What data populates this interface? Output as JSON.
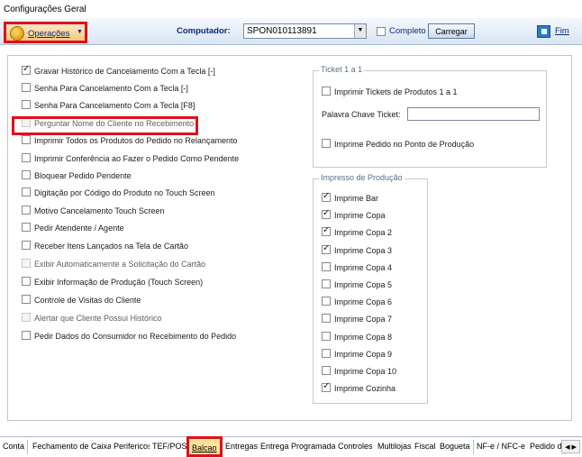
{
  "window_title": "Configurações Geral",
  "toolbar": {
    "operacoes_label": "Operações",
    "computador_label": "Computador:",
    "computador_value": "SPON010113891",
    "completo_label": "Completo",
    "carregar_label": "Carregar",
    "fim_label": "Fim"
  },
  "left_options": [
    {
      "label": "Gravar Histórico de Cancelamento Com a Tecla [-]",
      "checked": true,
      "enabled": true
    },
    {
      "label": "Senha Para Cancelamento Com a Tecla [-]",
      "checked": false,
      "enabled": true
    },
    {
      "label": "Senha Para Cancelamento Com a Tecla [F8]",
      "checked": false,
      "enabled": true
    },
    {
      "label": "Perguntar Nome do Cliente no Recebimento",
      "checked": false,
      "enabled": false
    },
    {
      "label": "Imprimir Todos os Produtos do Pedido no Relançamento",
      "checked": false,
      "enabled": true
    },
    {
      "label": "Imprimir Conferência ao Fazer o Pedido Como Pendente",
      "checked": false,
      "enabled": true
    },
    {
      "label": "Bloquear Pedido Pendente",
      "checked": false,
      "enabled": true
    },
    {
      "label": "Digitação por Código do Produto no Touch Screen",
      "checked": false,
      "enabled": true
    },
    {
      "label": "Motivo Cancelamento Touch Screen",
      "checked": false,
      "enabled": true
    },
    {
      "label": "Pedir Atendente / Agente",
      "checked": false,
      "enabled": true
    },
    {
      "label": "Receber Itens Lançados na Tela de Cartão",
      "checked": false,
      "enabled": true
    },
    {
      "label": "Exibir Automaticamente a Solicitação do Cartão",
      "checked": false,
      "enabled": false
    },
    {
      "label": "Exibir Informação de Produção (Touch Screen)",
      "checked": false,
      "enabled": true
    },
    {
      "label": "Controle de Visitas do Cliente",
      "checked": false,
      "enabled": true
    },
    {
      "label": "Alertar que Cliente Possui Histórico",
      "checked": false,
      "enabled": false
    },
    {
      "label": "Pedir Dados do Consumidor no Recebimento do Pedido",
      "checked": false,
      "enabled": true
    }
  ],
  "ticket_group": {
    "title": "Ticket 1 a 1",
    "imprimir_tickets_label": "Imprimir Tickets de Produtos 1 a 1",
    "palavra_chave_label": "Palavra Chave Ticket:",
    "palavra_chave_value": "",
    "imprime_pedido_label": "Imprime Pedido no Ponto de Produção"
  },
  "impresso_group": {
    "title": "Impresso de Produção",
    "items": [
      {
        "label": "Imprime Bar",
        "checked": true
      },
      {
        "label": "Imprime Copa",
        "checked": true
      },
      {
        "label": "Imprime Copa 2",
        "checked": true
      },
      {
        "label": "Imprime Copa 3",
        "checked": true
      },
      {
        "label": "Imprime Copa 4",
        "checked": false
      },
      {
        "label": "Imprime Copa 5",
        "checked": false
      },
      {
        "label": "Imprime Copa 6",
        "checked": false
      },
      {
        "label": "Imprime Copa 7",
        "checked": false
      },
      {
        "label": "Imprime Copa 8",
        "checked": false
      },
      {
        "label": "Imprime Copa 9",
        "checked": false
      },
      {
        "label": "Imprime Copa 10",
        "checked": false
      },
      {
        "label": "Imprime Cozinha",
        "checked": true
      }
    ]
  },
  "tabs": [
    {
      "label": "Conta",
      "active": false
    },
    {
      "label": "Fechamento de Caixa",
      "active": false
    },
    {
      "label": "Perifericos",
      "active": false
    },
    {
      "label": "TEF/POS",
      "active": false
    },
    {
      "label": "Balcao",
      "active": true
    },
    {
      "label": "Entregas",
      "active": false
    },
    {
      "label": "Entrega Programada",
      "active": false
    },
    {
      "label": "Controles",
      "active": false
    },
    {
      "label": "Multilojas",
      "active": false
    },
    {
      "label": "Fiscal",
      "active": false
    },
    {
      "label": "Bogueta",
      "active": false
    },
    {
      "label": "NF-e / NFC-e",
      "active": false
    },
    {
      "label": "Pedido d",
      "active": false
    }
  ],
  "colors": {
    "highlight_red": "#e0101a",
    "accent_blue": "#0b2a7a",
    "active_tab": "#ffe39a"
  }
}
